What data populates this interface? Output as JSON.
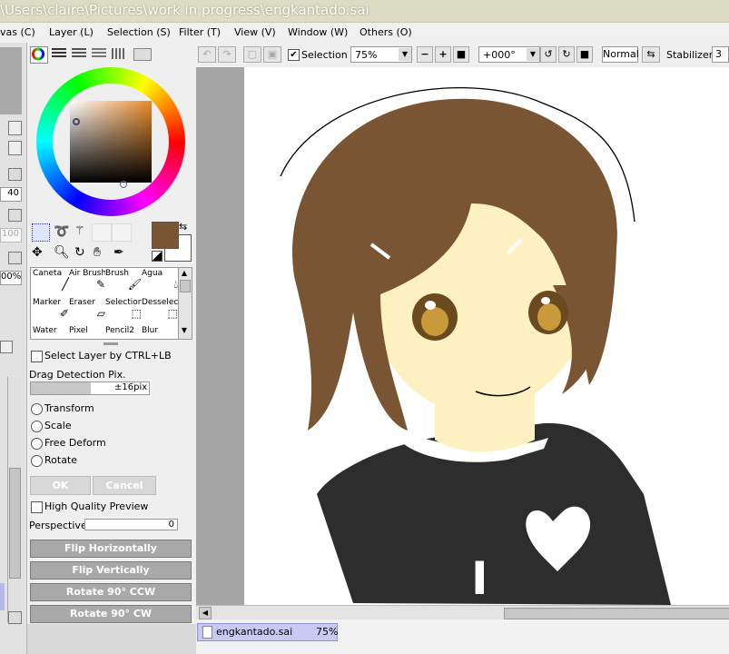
{
  "window": {
    "title": "\\Users\\claire\\Pictures\\work in progress\\engkantado.sai"
  },
  "menu": {
    "items": [
      "vas (C)",
      "Layer (L)",
      "Selection (S)",
      "Filter (T)",
      "View (V)",
      "Window (W)",
      "Others (O)"
    ]
  },
  "left_panel": {
    "values": [
      "40",
      "100",
      "00%"
    ]
  },
  "color": {
    "primary": "#7a5533",
    "secondary": "#ffffff"
  },
  "brushes": [
    "Caneta",
    "Air Brush",
    "Brush",
    "Água",
    "Marker",
    "Eraser",
    "Selection",
    "Desselect",
    "Water",
    "Pixel",
    "Pencil2",
    "Blur"
  ],
  "options": {
    "select_layer": "Select Layer by CTRL+LB",
    "drag_detection": "Drag Detection Pix.",
    "drag_value": "±16pix",
    "transform": "Transform",
    "scale": "Scale",
    "free_deform": "Free Deform",
    "rotate": "Rotate",
    "ok": "OK",
    "cancel": "Cancel",
    "hq_preview": "High Quality Preview",
    "perspective": "Perspective",
    "perspective_value": "0",
    "flip_h": "Flip Horizontally",
    "flip_v": "Flip Vertically",
    "rot_ccw": "Rotate 90° CCW",
    "rot_cw": "Rotate 90° CW"
  },
  "toolbar": {
    "selection": "Selection",
    "zoom": "75%",
    "angle": "+000°",
    "blend": "Normal",
    "stabilizer": "Stabilizer",
    "stabilizer_value": "3"
  },
  "doc": {
    "name": "engkantado.sai",
    "zoom": "75%"
  }
}
